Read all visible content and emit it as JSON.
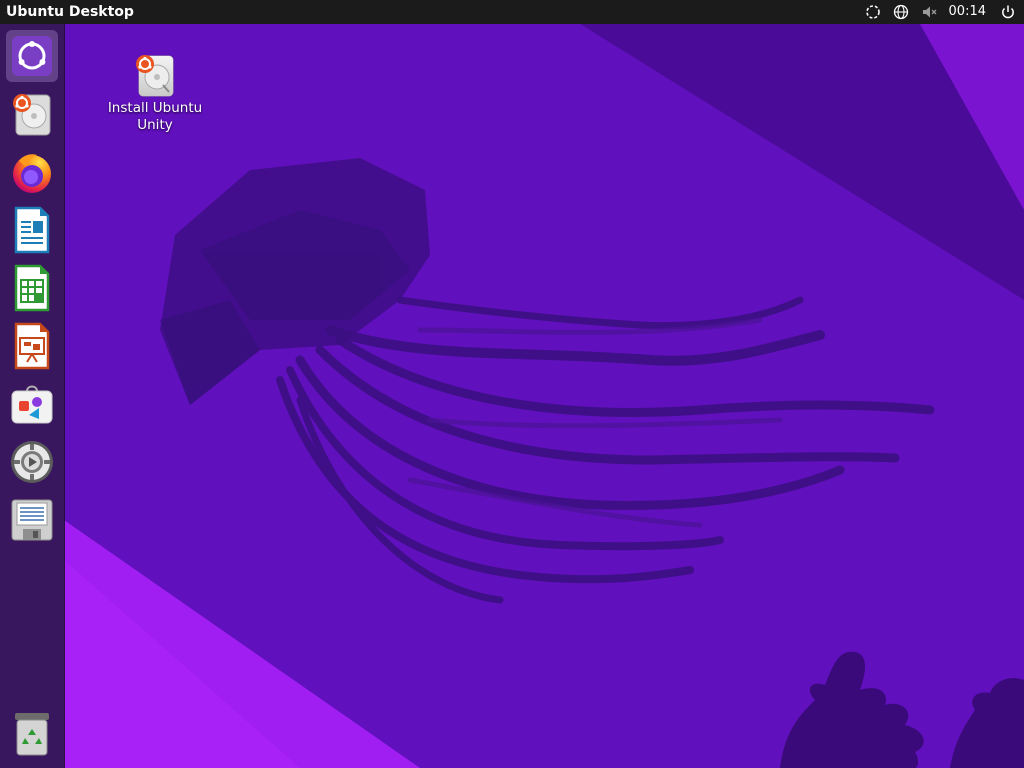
{
  "panel": {
    "title": "Ubuntu Desktop",
    "clock": "00:14"
  },
  "indicators": [
    "busy-spinner-icon",
    "network-globe-icon",
    "volume-muted-icon",
    "power-icon"
  ],
  "launcher": {
    "items": [
      {
        "name": "launcher-dash",
        "icon": "ubuntu-dash-icon",
        "active": true
      },
      {
        "name": "launcher-install-ubuntu",
        "icon": "disk-installer-icon"
      },
      {
        "name": "launcher-firefox",
        "icon": "firefox-icon"
      },
      {
        "name": "launcher-libreoffice-writer",
        "icon": "writer-document-icon"
      },
      {
        "name": "launcher-libreoffice-calc",
        "icon": "calc-spreadsheet-icon"
      },
      {
        "name": "launcher-libreoffice-impress",
        "icon": "impress-presentation-icon"
      },
      {
        "name": "launcher-software-center",
        "icon": "software-store-icon"
      },
      {
        "name": "launcher-settings",
        "icon": "settings-gear-icon"
      },
      {
        "name": "launcher-save-device",
        "icon": "floppy-document-icon"
      },
      {
        "name": "launcher-trash",
        "icon": "trash-icon"
      }
    ]
  },
  "desktop": {
    "icons": [
      {
        "label": "Install Ubuntu Unity",
        "icon": "disk-installer-icon"
      }
    ]
  },
  "colors": {
    "panel_bg": "#1b1b1b",
    "wallpaper_base": "#6a12c2",
    "wallpaper_dark": "#3a0a7a",
    "wallpaper_light": "#9e1df5",
    "accent_orange": "#e95420"
  }
}
